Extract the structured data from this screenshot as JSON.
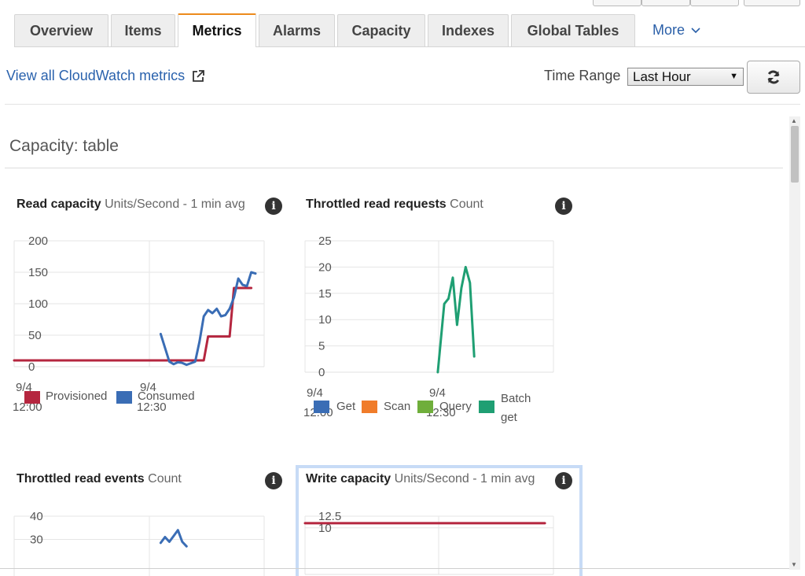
{
  "tabs": [
    {
      "label": "Overview"
    },
    {
      "label": "Items"
    },
    {
      "label": "Metrics"
    },
    {
      "label": "Alarms"
    },
    {
      "label": "Capacity"
    },
    {
      "label": "Indexes"
    },
    {
      "label": "Global Tables"
    }
  ],
  "more_label": "More",
  "toolbar": {
    "cloudwatch_link": "View all CloudWatch metrics",
    "time_range_label": "Time Range",
    "time_range_value": "Last Hour"
  },
  "section_title": "Capacity: table",
  "charts": {
    "read_capacity": {
      "title": "Read capacity",
      "unit": "Units/Second - 1 min avg"
    },
    "throttled_read_requests": {
      "title": "Throttled read requests",
      "unit": "Count"
    },
    "throttled_read_events": {
      "title": "Throttled read events",
      "unit": "Count"
    },
    "write_capacity": {
      "title": "Write capacity",
      "unit": "Units/Second - 1 min avg"
    }
  },
  "colors": {
    "provisioned": "#b5263f",
    "consumed": "#3a6db5",
    "get": "#3a6db5",
    "scan": "#f07c2a",
    "query": "#6fae3b",
    "batch_get": "#1f9f73",
    "accent_tab": "#ec8a1c"
  },
  "chart_data": [
    {
      "type": "line",
      "title": "Read capacity",
      "ylim": [
        0,
        200
      ],
      "yticks": [
        "0",
        "50",
        "100",
        "150",
        "200"
      ],
      "xticks": [
        [
          "9/4",
          "12:00"
        ],
        [
          "9/4",
          "12:30"
        ]
      ],
      "series": [
        {
          "name": "Provisioned",
          "color": "#b5263f",
          "points": [
            [
              0,
              10
            ],
            [
              44,
              10
            ],
            [
              45,
              48
            ],
            [
              50,
              48
            ],
            [
              51,
              125
            ],
            [
              55,
              125
            ]
          ]
        },
        {
          "name": "Consumed",
          "color": "#3a6db5",
          "points": [
            [
              34,
              52
            ],
            [
              36,
              8
            ],
            [
              37,
              4
            ],
            [
              38,
              7
            ],
            [
              39,
              6
            ],
            [
              40,
              3
            ],
            [
              42,
              8
            ],
            [
              43,
              40
            ],
            [
              44,
              80
            ],
            [
              45,
              90
            ],
            [
              46,
              85
            ],
            [
              47,
              92
            ],
            [
              48,
              80
            ],
            [
              49,
              82
            ],
            [
              50,
              92
            ],
            [
              51,
              110
            ],
            [
              52,
              140
            ],
            [
              53,
              130
            ],
            [
              54,
              128
            ],
            [
              55,
              150
            ],
            [
              56,
              148
            ]
          ]
        }
      ]
    },
    {
      "type": "line",
      "title": "Throttled read requests",
      "ylim": [
        0,
        25
      ],
      "yticks": [
        "0",
        "5",
        "10",
        "15",
        "20",
        "25"
      ],
      "xticks": [
        [
          "9/4",
          "12:00"
        ],
        [
          "9/4",
          "12:30"
        ]
      ],
      "legend": [
        "Get",
        "Scan",
        "Query",
        "Batch get"
      ],
      "series": [
        {
          "name": "Batch get",
          "color": "#1f9f73",
          "points": [
            [
              31,
              0
            ],
            [
              32.5,
              13
            ],
            [
              33.5,
              14
            ],
            [
              34.5,
              18
            ],
            [
              35.5,
              9
            ],
            [
              36.5,
              16
            ],
            [
              37.5,
              20
            ],
            [
              38.5,
              17
            ],
            [
              39.5,
              3
            ]
          ]
        }
      ]
    },
    {
      "type": "line",
      "title": "Throttled read events",
      "yticks": [
        "30",
        "40"
      ],
      "series": [
        {
          "name": "",
          "color": "#3a6db5",
          "points": [
            [
              34,
              28.5
            ],
            [
              35,
              31
            ],
            [
              36,
              29
            ],
            [
              37,
              31.5
            ],
            [
              38,
              34
            ],
            [
              39,
              29
            ],
            [
              40,
              27
            ]
          ]
        }
      ]
    },
    {
      "type": "line",
      "title": "Write capacity",
      "yticks": [
        "10",
        "12.5"
      ],
      "series": [
        {
          "name": "",
          "color": "#b5263f",
          "points": [
            [
              0,
              11
            ],
            [
              56,
              11
            ]
          ]
        }
      ]
    }
  ]
}
